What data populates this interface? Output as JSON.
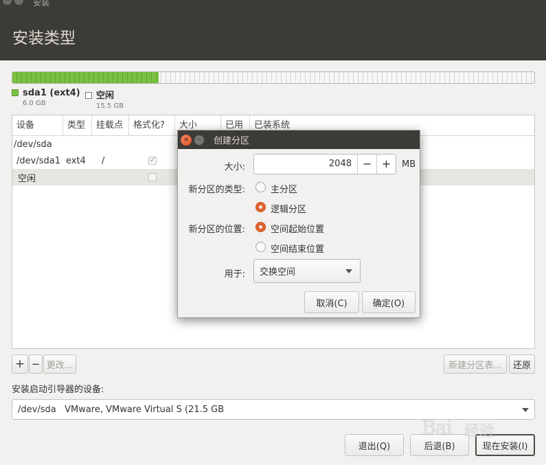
{
  "window": {
    "title": "安装",
    "page_title": "安装类型"
  },
  "partition_bar": {
    "used_fraction": 0.28,
    "legend": [
      {
        "name": "sda1 (ext4)",
        "size": "6.0 GB",
        "color": "#7ac142"
      },
      {
        "name": "空闲",
        "size": "15.5 GB",
        "color": "#ffffff"
      }
    ]
  },
  "table": {
    "headers": [
      "设备",
      "类型",
      "挂载点",
      "格式化?",
      "大小",
      "已用",
      "已装系统"
    ],
    "rows": [
      {
        "device": "/dev/sda",
        "type": "",
        "mount": ""
      },
      {
        "device": "/dev/sda1",
        "type": "ext4",
        "mount": "/",
        "format_checked": true
      },
      {
        "device": "空闲",
        "type": "",
        "mount": "",
        "format_checked": false
      }
    ]
  },
  "table_buttons": {
    "add": "+",
    "remove": "−",
    "change": "更改...",
    "new_table": "新建分区表...",
    "revert": "还原"
  },
  "bootloader": {
    "label": "安装启动引导器的设备:",
    "value": "/dev/sda   VMware, VMware Virtual S (21.5 GB"
  },
  "bottom_buttons": {
    "quit": "退出(Q)",
    "back": "后退(B)",
    "install_now": "现在安装(I)"
  },
  "dialog": {
    "title": "创建分区",
    "size_label": "大小:",
    "size_value": "2048",
    "size_minus": "−",
    "size_plus": "+",
    "size_unit": "MB",
    "type_label": "新分区的类型:",
    "type_primary": "主分区",
    "type_logical": "逻辑分区",
    "location_label": "新分区的位置:",
    "location_start": "空间起始位置",
    "location_end": "空间结束位置",
    "use_label": "用于:",
    "use_value": "交换空间",
    "cancel": "取消(C)",
    "ok": "确定(O)"
  },
  "watermark": {
    "text": "Bai",
    "sub": "经验"
  }
}
